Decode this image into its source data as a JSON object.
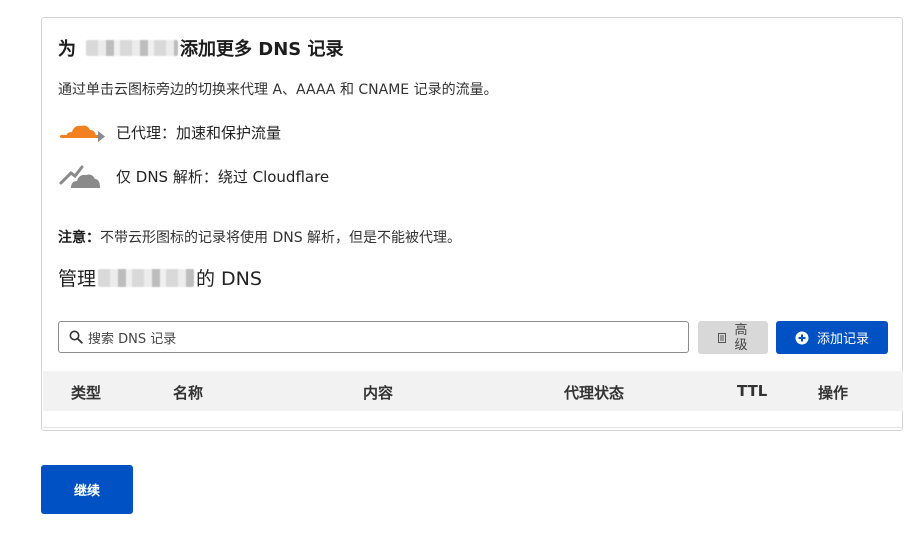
{
  "card": {
    "title_prefix": "为",
    "title_suffix": "添加更多 DNS 记录",
    "description": "通过单击云图标旁边的切换来代理 A、AAAA 和 CNAME 记录的流量。",
    "legend": [
      {
        "icon": "proxied-cloud-icon",
        "label": "已代理：加速和保护流量",
        "color": "#f38020"
      },
      {
        "icon": "dns-only-cloud-icon",
        "label": "仅 DNS 解析：绕过 Cloudflare",
        "color": "#8a8a8a"
      }
    ],
    "note_label": "注意：",
    "note_text": "不带云形图标的记录将使用 DNS 解析，但是不能被代理。",
    "manage_prefix": "管理",
    "manage_suffix": "的 DNS"
  },
  "search": {
    "placeholder": "搜索 DNS 记录",
    "icon": "search-icon"
  },
  "buttons": {
    "advanced": "高级",
    "add_record": "添加记录",
    "continue": "继续"
  },
  "table": {
    "headers": [
      "类型",
      "名称",
      "内容",
      "代理状态",
      "TTL",
      "操作"
    ]
  },
  "colors": {
    "accent": "#0051c3",
    "proxied": "#f38020",
    "dns_only": "#8a8a8a"
  }
}
